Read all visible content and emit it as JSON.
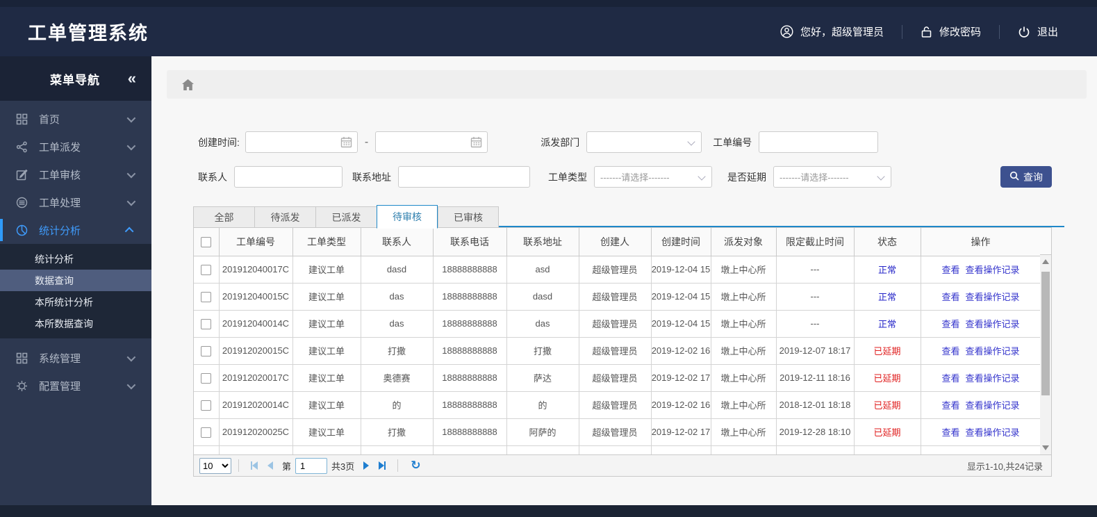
{
  "app": {
    "title": "工单管理系统"
  },
  "header": {
    "greeting": "您好，超级管理员",
    "change_password": "修改密码",
    "logout": "退出"
  },
  "sidebar": {
    "title": "菜单导航",
    "collapse_icon": "«",
    "items": [
      {
        "label": "首页",
        "icon": "grid-icon"
      },
      {
        "label": "工单派发",
        "icon": "share-icon"
      },
      {
        "label": "工单审核",
        "icon": "edit-icon"
      },
      {
        "label": "工单处理",
        "icon": "database-icon"
      },
      {
        "label": "统计分析",
        "icon": "pie-chart-icon",
        "active": true,
        "children": [
          {
            "label": "统计分析"
          },
          {
            "label": "数据查询",
            "selected": true
          },
          {
            "label": "本所统计分析"
          },
          {
            "label": "本所数据查询"
          }
        ]
      },
      {
        "label": "系统管理",
        "icon": "apps-icon"
      },
      {
        "label": "配置管理",
        "icon": "gear-icon"
      }
    ]
  },
  "filters": {
    "create_time_label": "创建时间:",
    "date_separator": "-",
    "date_start_value": "",
    "date_end_value": "",
    "dispatch_dept_label": "派发部门",
    "dispatch_dept_value": "",
    "order_no_label": "工单编号",
    "order_no_value": "",
    "contact_label": "联系人",
    "contact_value": "",
    "address_label": "联系地址",
    "address_value": "",
    "order_type_label": "工单类型",
    "delay_label": "是否延期",
    "select_placeholder": "-------请选择-------",
    "search_button": "查询"
  },
  "tabs": [
    {
      "label": "全部"
    },
    {
      "label": "待派发"
    },
    {
      "label": "已派发"
    },
    {
      "label": "待审核",
      "active": true
    },
    {
      "label": "已审核"
    }
  ],
  "table": {
    "columns": [
      "工单编号",
      "工单类型",
      "联系人",
      "联系电话",
      "联系地址",
      "创建人",
      "创建时间",
      "派发对象",
      "限定截止时间",
      "状态",
      "操作"
    ],
    "ops": {
      "view": "查看",
      "view_log": "查看操作记录"
    },
    "rows": [
      {
        "order_no": "201912040017C",
        "type": "建议工单",
        "contact": "dasd",
        "phone": "18888888888",
        "address": "asd",
        "creator": "超级管理员",
        "created": "2019-12-04 15",
        "target": "墩上中心所",
        "deadline": "---",
        "status": "正常",
        "status_type": "normal"
      },
      {
        "order_no": "201912040015C",
        "type": "建议工单",
        "contact": "das",
        "phone": "18888888888",
        "address": "dasd",
        "creator": "超级管理员",
        "created": "2019-12-04 15",
        "target": "墩上中心所",
        "deadline": "---",
        "status": "正常",
        "status_type": "normal"
      },
      {
        "order_no": "201912040014C",
        "type": "建议工单",
        "contact": "das",
        "phone": "18888888888",
        "address": "das",
        "creator": "超级管理员",
        "created": "2019-12-04 15",
        "target": "墩上中心所",
        "deadline": "---",
        "status": "正常",
        "status_type": "normal"
      },
      {
        "order_no": "201912020015C",
        "type": "建议工单",
        "contact": "打撒",
        "phone": "18888888888",
        "address": "打撒",
        "creator": "超级管理员",
        "created": "2019-12-02 16",
        "target": "墩上中心所",
        "deadline": "2019-12-07 18:17",
        "status": "已延期",
        "status_type": "delayed"
      },
      {
        "order_no": "201912020017C",
        "type": "建议工单",
        "contact": "奥德赛",
        "phone": "18888888888",
        "address": "萨达",
        "creator": "超级管理员",
        "created": "2019-12-02 17",
        "target": "墩上中心所",
        "deadline": "2019-12-11 18:16",
        "status": "已延期",
        "status_type": "delayed"
      },
      {
        "order_no": "201912020014C",
        "type": "建议工单",
        "contact": "的",
        "phone": "18888888888",
        "address": "的",
        "creator": "超级管理员",
        "created": "2019-12-02 16",
        "target": "墩上中心所",
        "deadline": "2018-12-01 18:18",
        "status": "已延期",
        "status_type": "delayed"
      },
      {
        "order_no": "201912020025C",
        "type": "建议工单",
        "contact": "打撒",
        "phone": "18888888888",
        "address": "阿萨的",
        "creator": "超级管理员",
        "created": "2019-12-02 17",
        "target": "墩上中心所",
        "deadline": "2019-12-28 18:10",
        "status": "已延期",
        "status_type": "delayed"
      }
    ]
  },
  "pagination": {
    "page_size": "10",
    "prefix": "第",
    "current_page": "1",
    "total_pages": "共3页",
    "summary": "显示1-10,共24记录"
  },
  "colors": {
    "header_bg": "#1f2a44",
    "sidebar_bg": "#2d3850",
    "sidebar_active": "#3f9bfb",
    "submenu_selected_bg": "#4f5d7e",
    "tab_accent": "#1e88c9",
    "search_button_bg": "#3d518f",
    "status_normal": "#2424c8",
    "status_delayed": "#e01f1f",
    "link": "#3333cc"
  }
}
